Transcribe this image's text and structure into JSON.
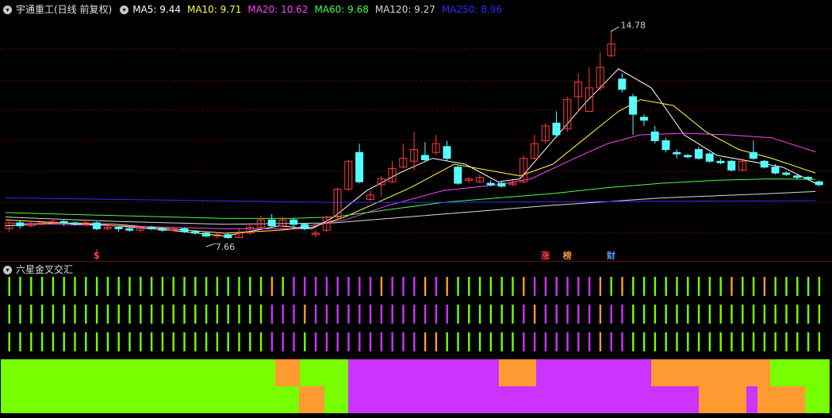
{
  "header": {
    "title": "宇通重工(日线 前复权)",
    "ma": [
      {
        "label": "MA5: 9.44",
        "color": "#ffffff"
      },
      {
        "label": "MA10: 9.71",
        "color": "#ffff44"
      },
      {
        "label": "MA20: 10.62",
        "color": "#ff44ff"
      },
      {
        "label": "MA60: 9.68",
        "color": "#44ff44"
      },
      {
        "label": "MA120: 9.27",
        "color": "#d8d8d8"
      },
      {
        "label": "MA250: 8.96",
        "color": "#2c2cff"
      }
    ]
  },
  "indicator": {
    "title": "六星金叉交汇"
  },
  "colors": {
    "up": "#ff3c3c",
    "down": "#54ffff",
    "grid": "#7a0000",
    "green": "#77ff00",
    "orange": "#ff9a33",
    "purple": "#cc33ff"
  },
  "chart_data": [
    {
      "type": "candlestick",
      "y_range": [
        7.2,
        15.2
      ],
      "max_label": "14.78",
      "min_label": "7.66",
      "markers": [
        {
          "index": 8,
          "text": "S",
          "color": "#ff3c3c"
        },
        {
          "index": 49,
          "text": "涨",
          "color": "#ff4040"
        },
        {
          "index": 51,
          "text": "榜",
          "color": "#ff9a40"
        },
        {
          "index": 55,
          "text": "财",
          "color": "#5599ff"
        }
      ],
      "candles": [
        [
          8.0,
          8.2,
          8.25,
          7.9
        ],
        [
          8.2,
          8.1,
          8.3,
          8.0
        ],
        [
          8.1,
          8.15,
          8.25,
          8.05
        ],
        [
          8.15,
          8.2,
          8.3,
          8.1
        ],
        [
          8.2,
          8.25,
          8.35,
          8.15
        ],
        [
          8.25,
          8.2,
          8.3,
          8.1
        ],
        [
          8.2,
          8.15,
          8.25,
          8.1
        ],
        [
          8.15,
          8.2,
          8.3,
          8.1
        ],
        [
          8.2,
          8.0,
          8.25,
          7.95
        ],
        [
          8.0,
          8.05,
          8.1,
          7.95
        ],
        [
          8.05,
          8.0,
          8.1,
          7.9
        ],
        [
          8.0,
          7.95,
          8.05,
          7.9
        ],
        [
          7.95,
          8.05,
          8.1,
          7.9
        ],
        [
          8.05,
          8.0,
          8.1,
          7.95
        ],
        [
          8.0,
          7.95,
          8.05,
          7.9
        ],
        [
          7.95,
          8.0,
          8.05,
          7.9
        ],
        [
          8.0,
          7.9,
          8.05,
          7.85
        ],
        [
          7.9,
          7.85,
          7.95,
          7.8
        ],
        [
          7.85,
          7.75,
          7.9,
          7.7
        ],
        [
          7.75,
          7.8,
          7.85,
          7.66
        ],
        [
          7.8,
          7.7,
          7.85,
          7.66
        ],
        [
          7.7,
          7.85,
          8.0,
          7.68
        ],
        [
          7.85,
          8.05,
          8.2,
          7.8
        ],
        [
          8.05,
          8.3,
          8.45,
          8.0
        ],
        [
          8.3,
          8.1,
          8.5,
          8.05
        ],
        [
          8.1,
          8.3,
          8.4,
          8.05
        ],
        [
          8.3,
          8.15,
          8.35,
          8.05
        ],
        [
          8.15,
          8.0,
          8.2,
          7.95
        ],
        [
          7.8,
          7.85,
          7.95,
          7.7
        ],
        [
          7.95,
          8.4,
          8.45,
          7.9
        ],
        [
          8.4,
          9.35,
          9.4,
          8.35
        ],
        [
          9.35,
          10.3,
          10.35,
          9.3
        ],
        [
          10.6,
          9.6,
          10.9,
          9.55
        ],
        [
          9.0,
          9.15,
          9.3,
          8.95
        ],
        [
          9.5,
          9.7,
          9.8,
          9.1
        ],
        [
          9.6,
          10.05,
          10.3,
          9.55
        ],
        [
          10.1,
          10.4,
          10.9,
          10.05
        ],
        [
          10.3,
          10.7,
          11.3,
          10.0
        ],
        [
          10.5,
          10.35,
          10.95,
          10.3
        ],
        [
          10.6,
          10.9,
          11.2,
          10.5
        ],
        [
          10.8,
          10.4,
          11.0,
          10.3
        ],
        [
          10.1,
          9.55,
          10.15,
          9.5
        ],
        [
          9.65,
          9.7,
          9.75,
          9.55
        ],
        [
          9.6,
          9.75,
          9.85,
          9.55
        ],
        [
          9.55,
          9.5,
          9.65,
          9.45
        ],
        [
          9.55,
          9.45,
          9.6,
          9.4
        ],
        [
          9.5,
          9.55,
          9.65,
          9.45
        ],
        [
          9.6,
          10.4,
          10.5,
          9.55
        ],
        [
          10.4,
          10.9,
          11.2,
          10.35
        ],
        [
          11.0,
          11.5,
          11.6,
          10.9
        ],
        [
          11.6,
          11.2,
          12.0,
          11.1
        ],
        [
          11.4,
          12.4,
          12.5,
          11.3
        ],
        [
          12.5,
          13.0,
          13.3,
          12.0
        ],
        [
          12.0,
          12.8,
          13.5,
          12.4
        ],
        [
          12.8,
          13.5,
          14.0,
          12.7
        ],
        [
          13.9,
          14.3,
          14.78,
          13.85
        ],
        [
          13.1,
          12.75,
          13.3,
          12.65
        ],
        [
          12.5,
          11.9,
          12.6,
          11.2
        ],
        [
          11.8,
          11.7,
          11.9,
          11.5
        ],
        [
          11.3,
          11.0,
          11.5,
          10.9
        ],
        [
          11.0,
          10.7,
          11.1,
          10.6
        ],
        [
          10.6,
          10.55,
          10.7,
          10.4
        ],
        [
          10.5,
          10.45,
          10.55,
          10.4
        ],
        [
          10.7,
          10.4,
          10.8,
          10.35
        ],
        [
          10.55,
          10.3,
          10.6,
          10.25
        ],
        [
          10.3,
          10.25,
          10.4,
          10.2
        ],
        [
          10.3,
          10.0,
          10.35,
          9.95
        ],
        [
          10.0,
          10.3,
          10.4,
          9.95
        ],
        [
          10.6,
          10.4,
          11.0,
          10.35
        ],
        [
          10.3,
          10.1,
          10.35,
          10.05
        ],
        [
          10.1,
          9.9,
          10.2,
          9.85
        ],
        [
          9.9,
          9.85,
          9.95,
          9.8
        ],
        [
          9.8,
          9.75,
          9.85,
          9.7
        ],
        [
          9.75,
          9.7,
          9.8,
          9.65
        ],
        [
          9.6,
          9.5,
          9.65,
          9.45
        ]
      ],
      "ma_lines": [
        {
          "name": "MA5",
          "color": "#ffffff",
          "points": [
            [
              0,
              8.1
            ],
            [
              5,
              8.2
            ],
            [
              10,
              8.1
            ],
            [
              15,
              7.95
            ],
            [
              20,
              7.75
            ],
            [
              25,
              8.1
            ],
            [
              28,
              8.0
            ],
            [
              30,
              8.4
            ],
            [
              33,
              9.3
            ],
            [
              36,
              9.9
            ],
            [
              39,
              10.4
            ],
            [
              42,
              10.2
            ],
            [
              45,
              9.6
            ],
            [
              47,
              9.7
            ],
            [
              50,
              11.0
            ],
            [
              53,
              12.3
            ],
            [
              56,
              13.45
            ],
            [
              59,
              12.8
            ],
            [
              62,
              11.2
            ],
            [
              65,
              10.5
            ],
            [
              68,
              10.3
            ],
            [
              71,
              10.1
            ],
            [
              74,
              9.55
            ]
          ]
        },
        {
          "name": "MA10",
          "color": "#ffff44",
          "points": [
            [
              0,
              8.3
            ],
            [
              5,
              8.2
            ],
            [
              10,
              8.15
            ],
            [
              15,
              8.0
            ],
            [
              20,
              7.85
            ],
            [
              25,
              7.95
            ],
            [
              28,
              8.05
            ],
            [
              31,
              8.4
            ],
            [
              34,
              8.9
            ],
            [
              37,
              9.4
            ],
            [
              41,
              10.2
            ],
            [
              44,
              10.0
            ],
            [
              47,
              9.8
            ],
            [
              50,
              10.2
            ],
            [
              53,
              11.1
            ],
            [
              56,
              12.0
            ],
            [
              58,
              12.4
            ],
            [
              61,
              12.2
            ],
            [
              64,
              11.3
            ],
            [
              67,
              10.7
            ],
            [
              70,
              10.4
            ],
            [
              74,
              9.9
            ]
          ]
        },
        {
          "name": "MA20",
          "color": "#ff44ff",
          "points": [
            [
              0,
              8.2
            ],
            [
              10,
              8.1
            ],
            [
              20,
              8.0
            ],
            [
              26,
              8.0
            ],
            [
              31,
              8.3
            ],
            [
              35,
              8.8
            ],
            [
              40,
              9.3
            ],
            [
              45,
              9.5
            ],
            [
              48,
              9.7
            ],
            [
              52,
              10.4
            ],
            [
              55,
              10.9
            ],
            [
              58,
              11.2
            ],
            [
              62,
              11.25
            ],
            [
              66,
              11.2
            ],
            [
              70,
              11.1
            ],
            [
              74,
              10.62
            ]
          ]
        },
        {
          "name": "MA60",
          "color": "#44ff44",
          "points": [
            [
              0,
              8.55
            ],
            [
              10,
              8.45
            ],
            [
              20,
              8.35
            ],
            [
              26,
              8.35
            ],
            [
              30,
              8.4
            ],
            [
              40,
              8.9
            ],
            [
              50,
              9.2
            ],
            [
              55,
              9.4
            ],
            [
              60,
              9.55
            ],
            [
              65,
              9.65
            ],
            [
              70,
              9.7
            ],
            [
              74,
              9.68
            ]
          ]
        },
        {
          "name": "MA120",
          "color": "#d8d8d8",
          "points": [
            [
              0,
              8.4
            ],
            [
              10,
              8.25
            ],
            [
              20,
              8.15
            ],
            [
              30,
              8.2
            ],
            [
              40,
              8.5
            ],
            [
              50,
              8.8
            ],
            [
              60,
              9.05
            ],
            [
              70,
              9.2
            ],
            [
              74,
              9.27
            ]
          ]
        },
        {
          "name": "MA250",
          "color": "#2c2cff",
          "points": [
            [
              0,
              9.05
            ],
            [
              10,
              9.0
            ],
            [
              20,
              8.95
            ],
            [
              30,
              8.9
            ],
            [
              40,
              8.9
            ],
            [
              50,
              8.92
            ],
            [
              60,
              8.94
            ],
            [
              70,
              8.95
            ],
            [
              74,
              8.96
            ]
          ]
        }
      ]
    },
    {
      "type": "signal_rows",
      "tick_rows": [
        [
          "g",
          "g",
          "g",
          "g",
          "g",
          "g",
          "g",
          "g",
          "g",
          "g",
          "g",
          "g",
          "g",
          "g",
          "g",
          "g",
          "g",
          "g",
          "g",
          "g",
          "g",
          "g",
          "g",
          "g",
          "o",
          "g",
          "p",
          "p",
          "p",
          "p",
          "p",
          "p",
          "p",
          "p",
          "o",
          "p",
          "p",
          "p",
          "o",
          "p",
          "o",
          "g",
          "g",
          "g",
          "g",
          "g",
          "g",
          "o",
          "p",
          "p",
          "p",
          "p",
          "p",
          "p",
          "o",
          "g",
          "o",
          "g",
          "g",
          "g",
          "g",
          "g",
          "g",
          "g",
          "g",
          "g",
          "o",
          "g",
          "g",
          "o",
          "g",
          "g",
          "g",
          "g",
          "g"
        ],
        [
          "g",
          "g",
          "g",
          "g",
          "g",
          "g",
          "g",
          "g",
          "g",
          "g",
          "g",
          "g",
          "g",
          "g",
          "g",
          "g",
          "g",
          "g",
          "g",
          "g",
          "g",
          "g",
          "g",
          "g",
          "p",
          "p",
          "p",
          "o",
          "p",
          "p",
          "p",
          "p",
          "p",
          "p",
          "p",
          "p",
          "p",
          "p",
          "p",
          "p",
          "p",
          "g",
          "g",
          "g",
          "g",
          "g",
          "g",
          "p",
          "o",
          "p",
          "p",
          "p",
          "p",
          "p",
          "o",
          "p",
          "p",
          "g",
          "g",
          "g",
          "g",
          "g",
          "g",
          "g",
          "g",
          "g",
          "g",
          "g",
          "g",
          "g",
          "g",
          "g",
          "g",
          "g",
          "g"
        ],
        [
          "g",
          "g",
          "g",
          "g",
          "g",
          "g",
          "g",
          "g",
          "g",
          "g",
          "g",
          "g",
          "g",
          "g",
          "g",
          "g",
          "g",
          "g",
          "g",
          "g",
          "g",
          "g",
          "g",
          "g",
          "p",
          "p",
          "p",
          "g",
          "p",
          "p",
          "p",
          "p",
          "p",
          "p",
          "p",
          "p",
          "p",
          "p",
          "o",
          "o",
          "g",
          "g",
          "g",
          "g",
          "g",
          "g",
          "g",
          "p",
          "p",
          "p",
          "p",
          "p",
          "p",
          "p",
          "o",
          "p",
          "p",
          "g",
          "g",
          "g",
          "g",
          "g",
          "g",
          "g",
          "g",
          "g",
          "g",
          "g",
          "g",
          "g",
          "g",
          "g",
          "g",
          "g",
          "g"
        ]
      ],
      "bands": [
        [
          [
            "g",
            0,
            346
          ],
          [
            "o",
            346,
            377
          ],
          [
            "g",
            377,
            438
          ],
          [
            "p",
            438,
            628
          ],
          [
            "o",
            628,
            675
          ],
          [
            "p",
            675,
            820
          ],
          [
            "o",
            820,
            970
          ],
          [
            "g",
            970,
            1045
          ]
        ],
        [
          [
            "g",
            0,
            376
          ],
          [
            "o",
            376,
            408
          ],
          [
            "g",
            408,
            438
          ],
          [
            "p",
            438,
            880
          ],
          [
            "o",
            880,
            940
          ],
          [
            "p",
            940,
            954
          ],
          [
            "o",
            954,
            1014
          ],
          [
            "g",
            1014,
            1045
          ]
        ]
      ]
    }
  ]
}
